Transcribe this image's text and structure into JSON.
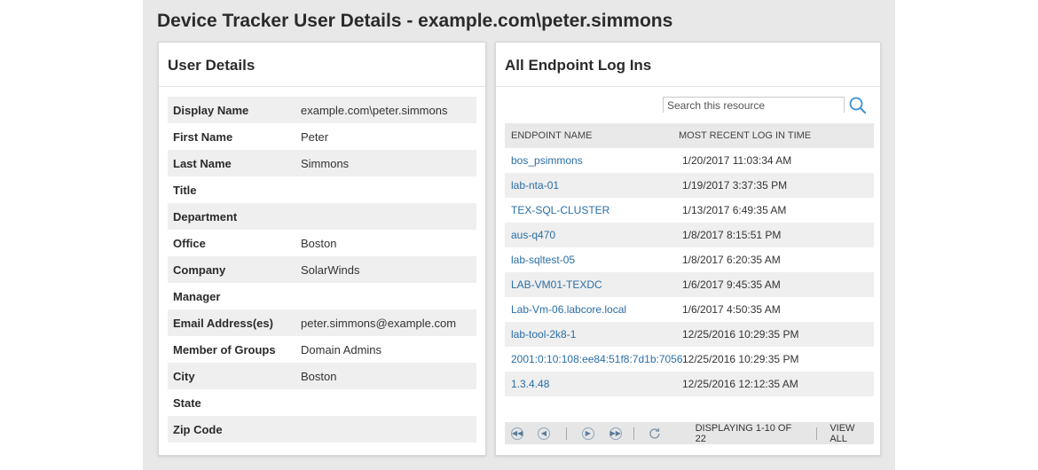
{
  "page": {
    "title": "Device Tracker User Details - example.com\\peter.simmons"
  },
  "user_details": {
    "title": "User Details",
    "rows": [
      {
        "label": "Display Name",
        "value": "example.com\\peter.simmons"
      },
      {
        "label": "First Name",
        "value": "Peter"
      },
      {
        "label": "Last Name",
        "value": "Simmons"
      },
      {
        "label": "Title",
        "value": ""
      },
      {
        "label": "Department",
        "value": ""
      },
      {
        "label": "Office",
        "value": "Boston"
      },
      {
        "label": "Company",
        "value": "SolarWinds"
      },
      {
        "label": "Manager",
        "value": ""
      },
      {
        "label": "Email Address(es)",
        "value": "peter.simmons@example.com"
      },
      {
        "label": "Member of Groups",
        "value": "Domain Admins"
      },
      {
        "label": "City",
        "value": "Boston"
      },
      {
        "label": "State",
        "value": ""
      },
      {
        "label": "Zip Code",
        "value": ""
      }
    ]
  },
  "endpoints": {
    "title": "All Endpoint Log Ins",
    "search_placeholder": "Search this resource",
    "columns": [
      "ENDPOINT NAME",
      "MOST RECENT LOG IN TIME"
    ],
    "rows": [
      {
        "name": "bos_psimmons",
        "time": "1/20/2017 11:03:34 AM"
      },
      {
        "name": "lab-nta-01",
        "time": "1/19/2017 3:37:35 PM"
      },
      {
        "name": "TEX-SQL-CLUSTER",
        "time": "1/13/2017 6:49:35 AM"
      },
      {
        "name": "aus-q470",
        "time": "1/8/2017 8:15:51 PM"
      },
      {
        "name": "lab-sqltest-05",
        "time": "1/8/2017 6:20:35 AM"
      },
      {
        "name": "LAB-VM01-TEXDC",
        "time": "1/6/2017 9:45:35 AM"
      },
      {
        "name": "Lab-Vm-06.labcore.local",
        "time": "1/6/2017 4:50:35 AM"
      },
      {
        "name": "lab-tool-2k8-1",
        "time": "12/25/2016 10:29:35 PM"
      },
      {
        "name": "2001:0:10:108:ee84:51f8:7d1b:7056",
        "time": "12/25/2016 10:29:35 PM"
      },
      {
        "name": "1.3.4.48",
        "time": "12/25/2016 12:12:35 AM"
      }
    ],
    "pager": {
      "display_text": "DISPLAYING 1-10 OF 22",
      "view_all": "VIEW ALL"
    }
  },
  "icons": [
    "search-icon",
    "first-page-icon",
    "previous-page-icon",
    "next-page-icon",
    "last-page-icon",
    "refresh-icon"
  ],
  "colors": {
    "link": "#2a6ea6",
    "search_icon": "#3a8fd0",
    "pager_icon": "#5d7c99"
  }
}
